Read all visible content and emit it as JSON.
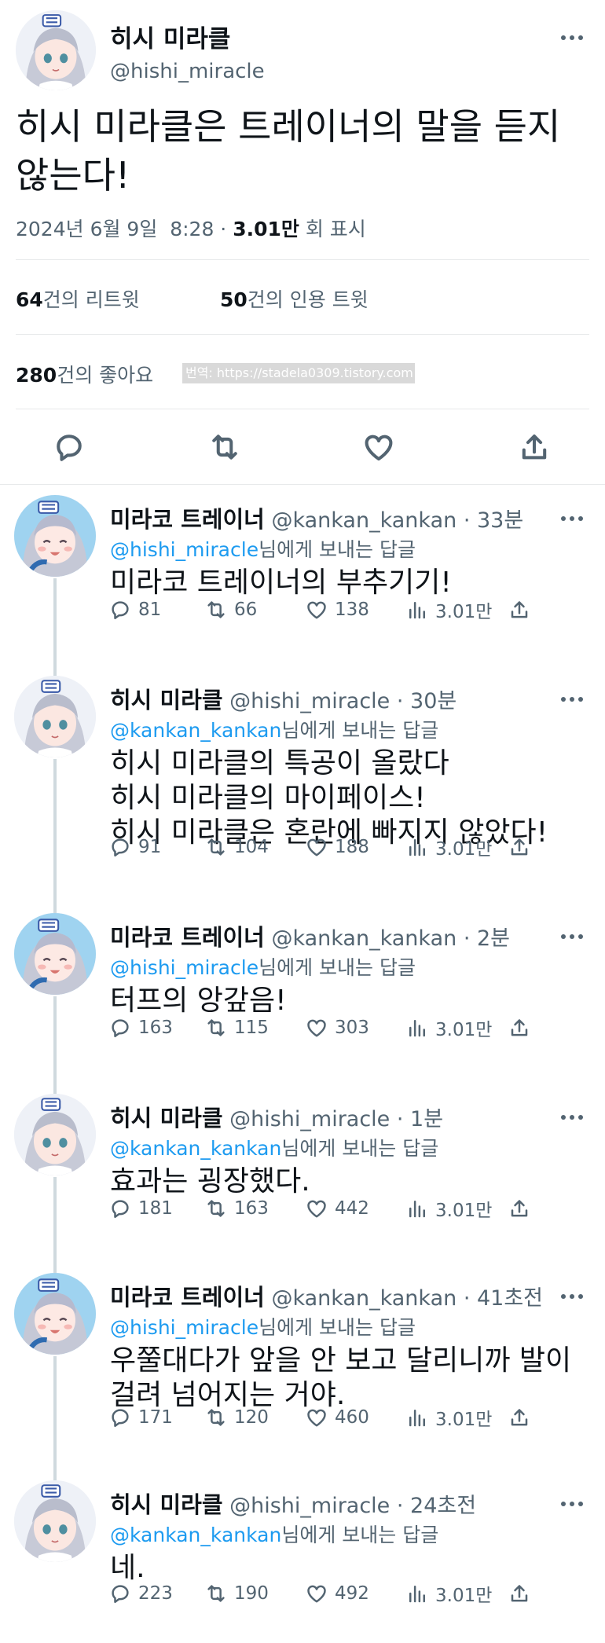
{
  "main": {
    "name": "히시 미라클",
    "handle": "@hishi_miracle",
    "text_line1": "히시 미라클은 트레이너의 말을 듣지",
    "text_line2": "않는다!",
    "date": "2024년 6월 9일  8:28 · ",
    "views_count": "3.01만",
    "views_label": " 회 표시",
    "retweets_count": "64",
    "retweets_label": "건의 리트윗",
    "quotes_count": "50",
    "quotes_label": "건의 인용 트윗",
    "likes_count": "280",
    "likes_label": "건의 좋아요",
    "watermark": "번역: https://stadela0309.tistory.com"
  },
  "colors": {
    "link": "#1d9bf0",
    "muted": "#536471",
    "text": "#0f1419",
    "divider": "#e7e9ea"
  },
  "icons": [
    "reply-icon",
    "retweet-icon",
    "like-icon",
    "share-icon",
    "views-icon",
    "more-icon"
  ],
  "replies": [
    {
      "name": "미라코 트레이너",
      "handle": "@kankan_kankan",
      "time": " · 33분",
      "to_mention": "@hishi_miracle",
      "to_suffix": "님에게 보내는 답글",
      "lines": [
        "미라코 트레이너의 부추기기!"
      ],
      "replies": "81",
      "retweets": "66",
      "likes": "138",
      "views": "3.01만",
      "avatar": "trainer"
    },
    {
      "name": "히시 미라클",
      "handle": "@hishi_miracle",
      "time": " · 30분",
      "to_mention": "@kankan_kankan",
      "to_suffix": "님에게 보내는 답글",
      "lines": [
        "히시 미라클의 특공이 올랐다",
        "히시 미라클의 마이페이스!",
        "히시 미라클은 혼란에 빠지지 않았다!"
      ],
      "replies": "91",
      "retweets": "104",
      "likes": "188",
      "views": "3.01만",
      "avatar": "hishi"
    },
    {
      "name": "미라코 트레이너",
      "handle": "@kankan_kankan",
      "time": " · 2분",
      "to_mention": "@hishi_miracle",
      "to_suffix": "님에게 보내는 답글",
      "lines": [
        "터프의 앙갚음!"
      ],
      "replies": "163",
      "retweets": "115",
      "likes": "303",
      "views": "3.01만",
      "avatar": "trainer"
    },
    {
      "name": "히시 미라클",
      "handle": "@hishi_miracle",
      "time": " · 1분",
      "to_mention": "@kankan_kankan",
      "to_suffix": "님에게 보내는 답글",
      "lines": [
        "효과는 굉장했다."
      ],
      "replies": "181",
      "retweets": "163",
      "likes": "442",
      "views": "3.01만",
      "avatar": "hishi"
    },
    {
      "name": "미라코 트레이너",
      "handle": "@kankan_kankan",
      "time": " · 41초전",
      "to_mention": "@hishi_miracle",
      "to_suffix": "님에게 보내는 답글",
      "lines": [
        "우쭐대다가 앞을 안 보고 달리니까 발이",
        "걸려 넘어지는 거야."
      ],
      "replies": "171",
      "retweets": "120",
      "likes": "460",
      "views": "3.01만",
      "avatar": "trainer"
    },
    {
      "name": "히시 미라클",
      "handle": "@hishi_miracle",
      "time": " · 24초전",
      "to_mention": "@kankan_kankan",
      "to_suffix": "님에게 보내는 답글",
      "lines": [
        "네."
      ],
      "replies": "223",
      "retweets": "190",
      "likes": "492",
      "views": "3.01만",
      "avatar": "hishi"
    }
  ]
}
